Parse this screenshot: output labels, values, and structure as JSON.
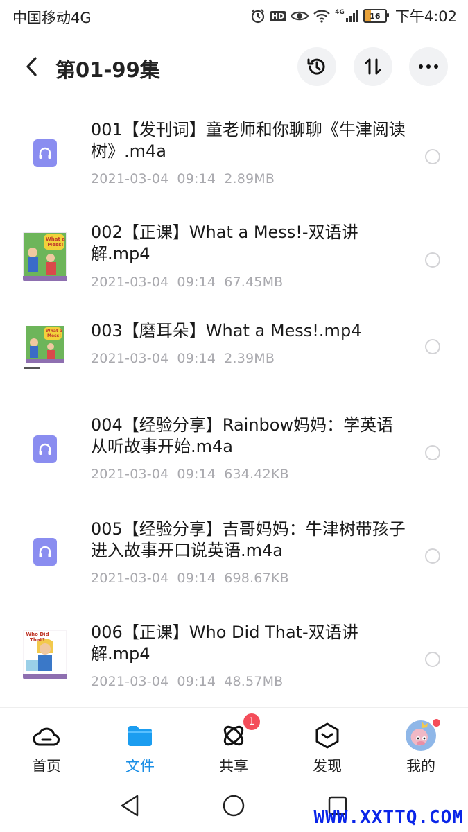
{
  "status_bar": {
    "carrier": "中国移动4G",
    "network_label": "4G",
    "hd_label": "HD",
    "battery_level": "16",
    "time": "下午4:02"
  },
  "header": {
    "title": "第01-99集",
    "icons": [
      "back-arrow-icon",
      "history-icon",
      "sort-icon",
      "more-icon"
    ]
  },
  "files": [
    {
      "name": "001【发刊词】童老师和你聊聊《牛津阅读树》.m4a",
      "date": "2021-03-04",
      "time": "09:14",
      "size": "2.89MB",
      "type": "audio"
    },
    {
      "name": "002【正课】What a Mess!-双语讲解.mp4",
      "date": "2021-03-04",
      "time": "09:14",
      "size": "67.45MB",
      "type": "video",
      "thumb_text": "What a Mess!"
    },
    {
      "name": "003【磨耳朵】What a Mess!.mp4",
      "date": "2021-03-04",
      "time": "09:14",
      "size": "2.39MB",
      "type": "video",
      "thumb_text": "What a Mess!"
    },
    {
      "name": "004【经验分享】Rainbow妈妈：学英语从听故事开始.m4a",
      "date": "2021-03-04",
      "time": "09:14",
      "size": "634.42KB",
      "type": "audio"
    },
    {
      "name": "005【经验分享】吉哥妈妈：牛津树带孩子进入故事开口说英语.m4a",
      "date": "2021-03-04",
      "time": "09:14",
      "size": "698.67KB",
      "type": "audio"
    },
    {
      "name": "006【正课】Who Did That-双语讲解.mp4",
      "date": "2021-03-04",
      "time": "09:14",
      "size": "48.57MB",
      "type": "video",
      "thumb_text": "Who Did That?"
    }
  ],
  "bottom_nav": [
    {
      "label": "首页",
      "icon": "cloud-home-icon",
      "active": false
    },
    {
      "label": "文件",
      "icon": "folder-icon",
      "active": true
    },
    {
      "label": "共享",
      "icon": "share-orbit-icon",
      "active": false,
      "badge": "1"
    },
    {
      "label": "发现",
      "icon": "discover-icon",
      "active": false
    },
    {
      "label": "我的",
      "icon": "avatar-icon",
      "active": false,
      "dot": true
    }
  ],
  "watermark": "WWW.XXTTQ.COM",
  "colors": {
    "accent": "#1b8fe6",
    "audio_icon": "#8a8df0",
    "badge": "#f44d5a",
    "meta_text": "#a9a9ae"
  }
}
